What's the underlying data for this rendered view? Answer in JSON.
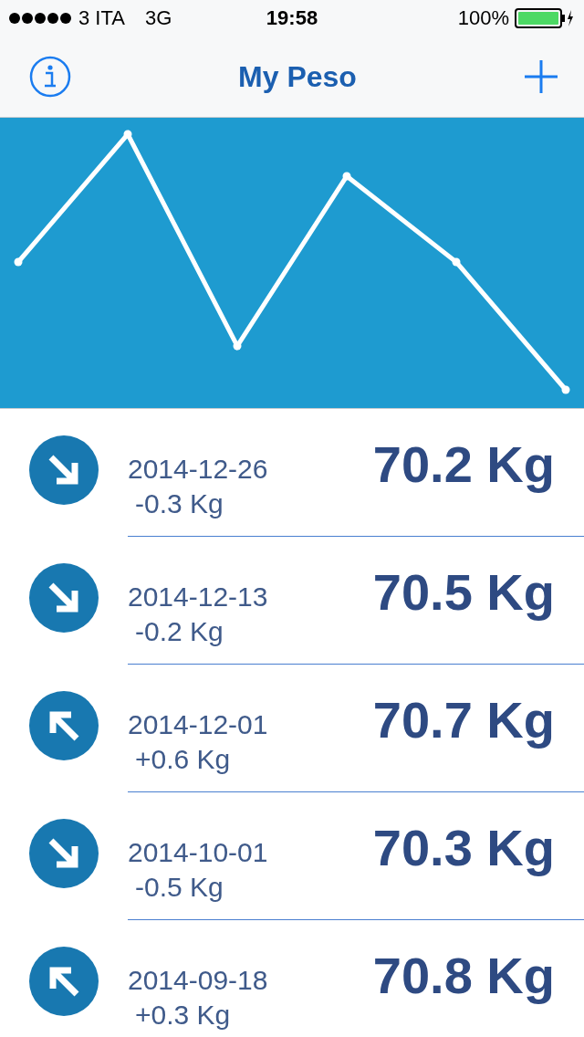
{
  "status_bar": {
    "carrier": "3 ITA",
    "network": "3G",
    "time": "19:58",
    "battery": "100%"
  },
  "nav": {
    "title": "My Peso"
  },
  "entries": [
    {
      "kind": "down",
      "date": "2014-12-26",
      "change": "-0.3 Kg",
      "weight": "70.2 Kg"
    },
    {
      "kind": "down",
      "date": "2014-12-13",
      "change": "-0.2 Kg",
      "weight": "70.5 Kg"
    },
    {
      "kind": "up",
      "date": "2014-12-01",
      "change": "+0.6 Kg",
      "weight": "70.7 Kg"
    },
    {
      "kind": "down",
      "date": "2014-10-01",
      "change": "-0.5 Kg",
      "weight": "70.3 Kg"
    },
    {
      "kind": "up",
      "date": "2014-09-18",
      "change": "+0.3 Kg",
      "weight": "70.8 Kg"
    }
  ]
}
